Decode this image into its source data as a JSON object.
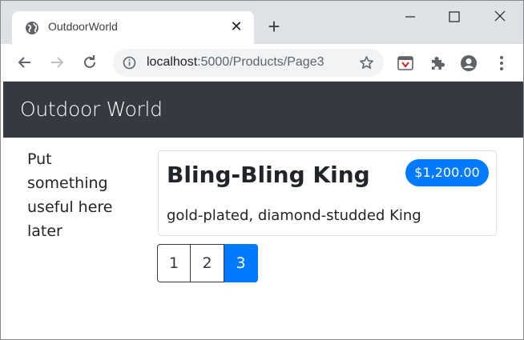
{
  "browser": {
    "tab": {
      "title": "OutdoorWorld",
      "favicon": "globe-icon",
      "close": "✕"
    },
    "new_tab": "+",
    "address": {
      "host": "localhost",
      "path": ":5000/Products/Page3"
    },
    "colors": {
      "tabstrip": "#dee1e6",
      "omnibox": "#f1f3f4"
    }
  },
  "navbar": {
    "brand": "Outdoor World",
    "bg": "#343a40"
  },
  "sidebar": {
    "text": "Put something useful here later"
  },
  "products": [
    {
      "name": "Bling-Bling King",
      "price": "$1,200.00",
      "description": "gold-plated, diamond-studded King"
    }
  ],
  "pagination": {
    "pages": [
      "1",
      "2",
      "3"
    ],
    "current": "3",
    "accent": "#007bff"
  }
}
